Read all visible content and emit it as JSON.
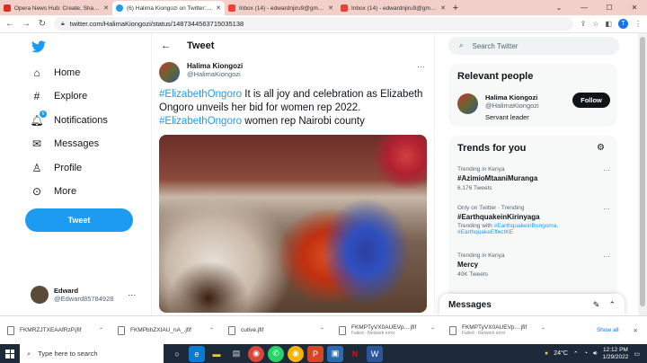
{
  "browser": {
    "tabs": [
      {
        "label": "Opera News Hub: Create, Share...",
        "color": "#d93025"
      },
      {
        "label": "(6) Halima Kiongozi on Twitter: \"#...",
        "color": "#1d9bf0"
      },
      {
        "label": "Inbox (14) - edwardnjiru9@gma...",
        "color": "#ea4335"
      },
      {
        "label": "Inbox (14) - edwardnjiru9@gma...",
        "color": "#ea4335"
      }
    ],
    "url": "twitter.com/HalimaKiongozi/status/1487344563715035138",
    "profile_initial": "T"
  },
  "sidebar": {
    "items": [
      {
        "label": "Home",
        "icon": "home-icon"
      },
      {
        "label": "Explore",
        "icon": "hashtag-icon"
      },
      {
        "label": "Notifications",
        "icon": "bell-icon",
        "badge": "6"
      },
      {
        "label": "Messages",
        "icon": "mail-icon"
      },
      {
        "label": "Profile",
        "icon": "person-icon"
      },
      {
        "label": "More",
        "icon": "more-circle-icon"
      }
    ],
    "tweet_button": "Tweet",
    "user": {
      "name": "Edward",
      "handle": "@Edward85784928"
    }
  },
  "main": {
    "header": "Tweet",
    "author": {
      "name": "Halima Kiongozi",
      "handle": "@HalimaKiongozi"
    },
    "text": {
      "tag1": "#ElizabethOngoro",
      "part1": " It is all joy and celebration as Elizabeth Ongoro unveils her bid for women rep 2022. ",
      "tag2": "#ElizabethOngoro",
      "part2": " women rep Nairobi county"
    }
  },
  "right": {
    "search_placeholder": "Search Twitter",
    "relevant": {
      "title": "Relevant people",
      "name": "Halima Kiongozi",
      "handle": "@HalimaKiongozi",
      "bio": "Servant leader",
      "follow": "Follow"
    },
    "trends": {
      "title": "Trends for you",
      "items": [
        {
          "meta": "Trending in Kenya",
          "name": "#AzimioMtaaniMuranga",
          "count": "6,176 Tweets"
        },
        {
          "meta": "Only on Twitter · Trending",
          "name": "#EarthquakeinKirinyaga",
          "extra_pre": "Trending with ",
          "extra_tags": "#EarthquakeinBungoma, #EarthquakeEffectKE"
        },
        {
          "meta": "Trending in Kenya",
          "name": "Mercy",
          "count": "40K Tweets"
        }
      ]
    },
    "messages": "Messages"
  },
  "downloads": {
    "items": [
      {
        "name": "FKMRZJTXEAAfRzP.jfif",
        "status": ""
      },
      {
        "name": "FKMPbhZXIAU_nA_.jfif",
        "status": ""
      },
      {
        "name": "cutive.jfif",
        "status": ""
      },
      {
        "name": "FKMPTyVX0AUEVp....jfif",
        "status": "Failed - Network error"
      },
      {
        "name": "FKMPTyVX0AUEVp....jfif",
        "status": "Failed - Network error"
      }
    ],
    "show_all": "Show all"
  },
  "taskbar": {
    "search": "Type here to search",
    "temp": "24°C",
    "time": "12:12 PM",
    "date": "1/29/2022"
  }
}
